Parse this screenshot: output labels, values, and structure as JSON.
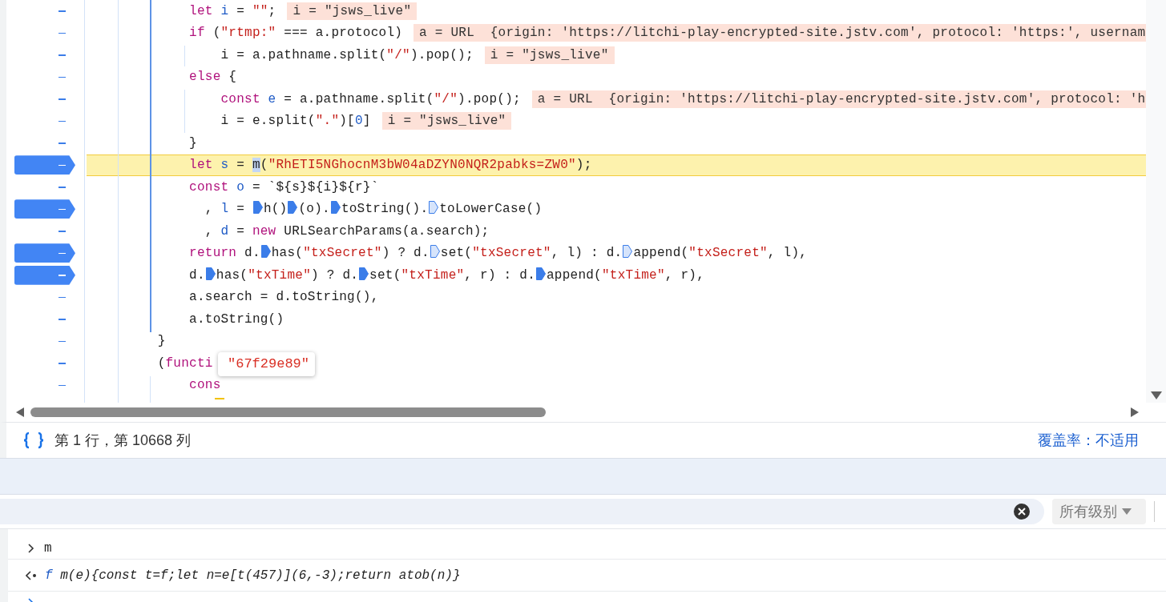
{
  "editor": {
    "lines": [
      {
        "breakpoint": false,
        "current": false,
        "tokens": [
          {
            "kind": "kw",
            "text": "             let "
          },
          {
            "kind": "var",
            "text": "i"
          },
          {
            "kind": "plain",
            "text": " = "
          },
          {
            "kind": "str",
            "text": "\"\""
          },
          {
            "kind": "plain",
            "text": ";"
          }
        ],
        "value_hint": "i = \"jsws_live\""
      },
      {
        "breakpoint": false,
        "current": false,
        "tokens": [
          {
            "kind": "kw",
            "text": "             if"
          },
          {
            "kind": "plain",
            "text": " ("
          },
          {
            "kind": "str",
            "text": "\"rtmp:\""
          },
          {
            "kind": "plain",
            "text": " === a.protocol)"
          }
        ],
        "value_hint": "a = URL  {origin: 'https://litchi-play-encrypted-site.jstv.com', protocol: 'https:', usernam"
      },
      {
        "breakpoint": false,
        "current": false,
        "tokens": [
          {
            "kind": "plain",
            "text": "                 i = a.pathname.split("
          },
          {
            "kind": "str",
            "text": "\"/\""
          },
          {
            "kind": "plain",
            "text": ").pop();"
          }
        ],
        "value_hint": "i = \"jsws_live\""
      },
      {
        "breakpoint": false,
        "current": false,
        "tokens": [
          {
            "kind": "kw",
            "text": "             else"
          },
          {
            "kind": "plain",
            "text": " {"
          }
        ]
      },
      {
        "breakpoint": false,
        "current": false,
        "tokens": [
          {
            "kind": "kw",
            "text": "                 const "
          },
          {
            "kind": "var",
            "text": "e"
          },
          {
            "kind": "plain",
            "text": " = a.pathname.split("
          },
          {
            "kind": "str",
            "text": "\"/\""
          },
          {
            "kind": "plain",
            "text": ").pop();"
          }
        ],
        "value_hint": "a = URL  {origin: 'https://litchi-play-encrypted-site.jstv.com', protocol: 'h"
      },
      {
        "breakpoint": false,
        "current": false,
        "tokens": [
          {
            "kind": "plain",
            "text": "                 i = e.split("
          },
          {
            "kind": "str",
            "text": "\".\""
          },
          {
            "kind": "plain",
            "text": ")["
          },
          {
            "kind": "num",
            "text": "0"
          },
          {
            "kind": "plain",
            "text": "]"
          }
        ],
        "value_hint": "i = \"jsws_live\""
      },
      {
        "breakpoint": false,
        "current": false,
        "tokens": [
          {
            "kind": "plain",
            "text": "             }"
          }
        ]
      },
      {
        "breakpoint": true,
        "current": true,
        "tokens": [
          {
            "kind": "kw",
            "text": "             let "
          },
          {
            "kind": "var",
            "text": "s"
          },
          {
            "kind": "plain",
            "text": " = "
          },
          {
            "kind": "sel",
            "text": "m"
          },
          {
            "kind": "plain",
            "text": "("
          },
          {
            "kind": "str",
            "text": "\"RhETI5NGhocnM3bW04aDZYN0NQR2pabks=ZW0\""
          },
          {
            "kind": "plain",
            "text": ");"
          }
        ]
      },
      {
        "breakpoint": false,
        "current": false,
        "tokens": [
          {
            "kind": "kw",
            "text": "             const "
          },
          {
            "kind": "var",
            "text": "o"
          },
          {
            "kind": "plain",
            "text": " = `${s}${i}${r}`"
          }
        ]
      },
      {
        "breakpoint": true,
        "current": false,
        "tokens": [
          {
            "kind": "plain",
            "text": "               , "
          },
          {
            "kind": "var",
            "text": "l"
          },
          {
            "kind": "plain",
            "text": " = "
          },
          {
            "kind": "marker",
            "active": true
          },
          {
            "kind": "plain",
            "text": "h()"
          },
          {
            "kind": "marker",
            "active": true
          },
          {
            "kind": "plain",
            "text": "(o)."
          },
          {
            "kind": "marker",
            "active": true
          },
          {
            "kind": "plain",
            "text": "toString()."
          },
          {
            "kind": "marker",
            "active": false
          },
          {
            "kind": "plain",
            "text": "toLowerCase()"
          }
        ]
      },
      {
        "breakpoint": false,
        "current": false,
        "tokens": [
          {
            "kind": "plain",
            "text": "               , "
          },
          {
            "kind": "var",
            "text": "d"
          },
          {
            "kind": "plain",
            "text": " = "
          },
          {
            "kind": "kw",
            "text": "new"
          },
          {
            "kind": "plain",
            "text": " URLSearchParams(a.search);"
          }
        ]
      },
      {
        "breakpoint": true,
        "current": false,
        "tokens": [
          {
            "kind": "kw",
            "text": "             return"
          },
          {
            "kind": "plain",
            "text": " d."
          },
          {
            "kind": "marker",
            "active": true
          },
          {
            "kind": "plain",
            "text": "has("
          },
          {
            "kind": "str",
            "text": "\"txSecret\""
          },
          {
            "kind": "plain",
            "text": ") ? d."
          },
          {
            "kind": "marker",
            "active": false
          },
          {
            "kind": "plain",
            "text": "set("
          },
          {
            "kind": "str",
            "text": "\"txSecret\""
          },
          {
            "kind": "plain",
            "text": ", l) : d."
          },
          {
            "kind": "marker",
            "active": false
          },
          {
            "kind": "plain",
            "text": "append("
          },
          {
            "kind": "str",
            "text": "\"txSecret\""
          },
          {
            "kind": "plain",
            "text": ", l),"
          }
        ]
      },
      {
        "breakpoint": true,
        "current": false,
        "tokens": [
          {
            "kind": "plain",
            "text": "             d."
          },
          {
            "kind": "marker",
            "active": true
          },
          {
            "kind": "plain",
            "text": "has("
          },
          {
            "kind": "str",
            "text": "\"txTime\""
          },
          {
            "kind": "plain",
            "text": ") ? d."
          },
          {
            "kind": "marker",
            "active": true
          },
          {
            "kind": "plain",
            "text": "set("
          },
          {
            "kind": "str",
            "text": "\"txTime\""
          },
          {
            "kind": "plain",
            "text": ", r) : d."
          },
          {
            "kind": "marker",
            "active": true
          },
          {
            "kind": "plain",
            "text": "append("
          },
          {
            "kind": "str",
            "text": "\"txTime\""
          },
          {
            "kind": "plain",
            "text": ", r),"
          }
        ]
      },
      {
        "breakpoint": false,
        "current": false,
        "tokens": [
          {
            "kind": "plain",
            "text": "             a.search = d.toString(),"
          }
        ]
      },
      {
        "breakpoint": false,
        "current": false,
        "tokens": [
          {
            "kind": "plain",
            "text": "             a.toString()"
          }
        ]
      },
      {
        "breakpoint": false,
        "current": false,
        "tokens": [
          {
            "kind": "plain",
            "text": "         }"
          }
        ]
      },
      {
        "breakpoint": false,
        "current": false,
        "tokens": [
          {
            "kind": "plain",
            "text": "         ("
          },
          {
            "kind": "kw",
            "text": "functi"
          }
        ]
      },
      {
        "breakpoint": false,
        "current": false,
        "tokens": [
          {
            "kind": "kw",
            "text": "             cons"
          }
        ]
      }
    ]
  },
  "tooltip": {
    "text": "\"67f29e89\""
  },
  "status_bar": {
    "position": "第 1 行，第 10668 列",
    "coverage": "覆盖率：不适用"
  },
  "console": {
    "filter": {
      "level_menu": "所有级别"
    },
    "entries": [
      {
        "kind": "input",
        "text": "m"
      },
      {
        "kind": "output",
        "prefix": "f",
        "text": "m(e){const t=f;let n=e[t(457)](6,-3);return atob(n)}"
      }
    ]
  }
}
